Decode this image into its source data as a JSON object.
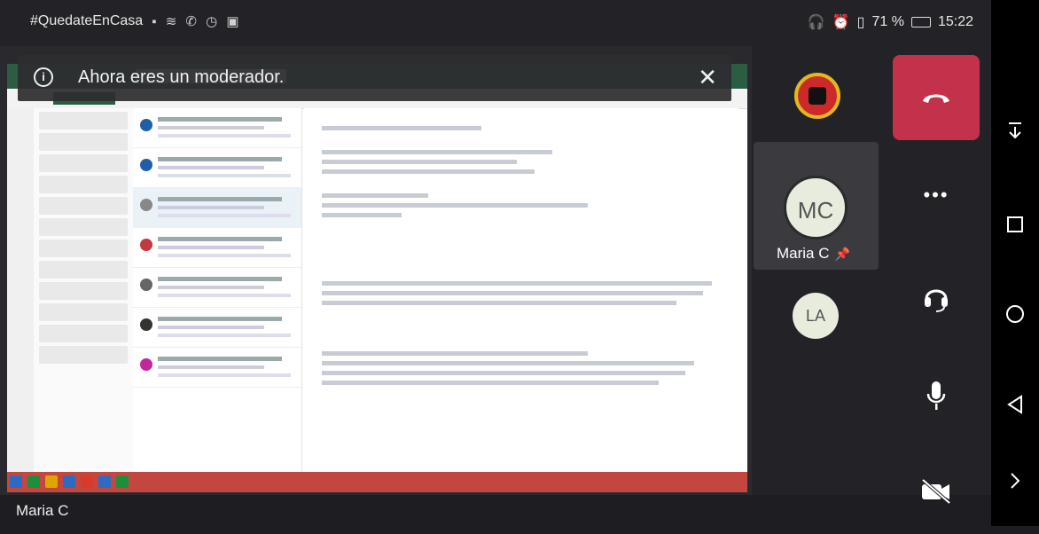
{
  "status_bar": {
    "hashtag": "#QuedateEnCasa",
    "battery_percent": "71 %",
    "time": "15:22"
  },
  "banner": {
    "message": "Ahora eres un moderador.",
    "close_symbol": "✕"
  },
  "stage": {
    "presenter_name": "Maria C"
  },
  "participants": [
    {
      "initials": "MC",
      "name": "Maria C",
      "pinned": true
    },
    {
      "initials": "LA"
    }
  ],
  "controls": {
    "more_symbol": "•••"
  },
  "icons": {
    "info": "info-icon",
    "close": "close-icon",
    "hangup": "phone-hangup-icon",
    "more": "more-options-icon",
    "audio": "headset-icon",
    "mic": "microphone-icon",
    "camera": "camera-off-icon",
    "pin": "pin-icon",
    "nav_down": "notification-shade-icon",
    "nav_recents": "recents-icon",
    "nav_home": "home-icon",
    "nav_back": "back-icon",
    "nav_expand": "chevron-right-icon"
  },
  "colors": {
    "hangup": "#c4314b",
    "avatar_bg": "#e8ecdd",
    "outlook_green": "#2b5d43"
  }
}
